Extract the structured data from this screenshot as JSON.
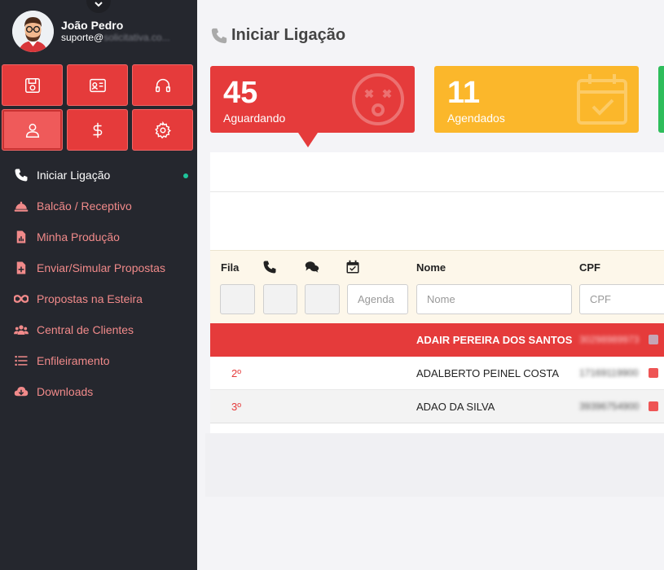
{
  "user": {
    "name": "João Pedro",
    "email_visible": "suporte@",
    "email_obscured": "solicitativa.co..."
  },
  "menu": [
    {
      "label": "Iniciar Ligação",
      "icon": "phone-icon",
      "active": true
    },
    {
      "label": "Balcão / Receptivo",
      "icon": "service-bell-icon"
    },
    {
      "label": "Minha Produção",
      "icon": "file-chart-icon"
    },
    {
      "label": "Enviar/Simular Propostas",
      "icon": "file-plus-icon"
    },
    {
      "label": "Propostas na Esteira",
      "icon": "infinity-icon"
    },
    {
      "label": "Central de Clientes",
      "icon": "users-icon"
    },
    {
      "label": "Enfileiramento",
      "icon": "list-icon"
    },
    {
      "label": "Downloads",
      "icon": "cloud-download-icon"
    }
  ],
  "page": {
    "title": "Iniciar Ligação"
  },
  "stats": [
    {
      "value": "45",
      "label": "Aguardando",
      "color": "#e53b3b"
    },
    {
      "value": "11",
      "label": "Agendados",
      "color": "#fbb72b"
    },
    {
      "color": "#2ebd5b"
    }
  ],
  "table": {
    "headers": {
      "fila": "Fila",
      "nome": "Nome",
      "cpf": "CPF"
    },
    "filters": {
      "agenda_placeholder": "Agenda",
      "nome_placeholder": "Nome",
      "cpf_placeholder": "CPF"
    },
    "rows": [
      {
        "pos": "",
        "name": "ADAIR PEREIRA DOS SANTOS",
        "cpf": "30298989973"
      },
      {
        "pos": "2º",
        "name": "ADALBERTO PEINEL COSTA",
        "cpf": "17169119900"
      },
      {
        "pos": "3º",
        "name": "ADAO DA SILVA",
        "cpf": "39396754900"
      }
    ]
  }
}
